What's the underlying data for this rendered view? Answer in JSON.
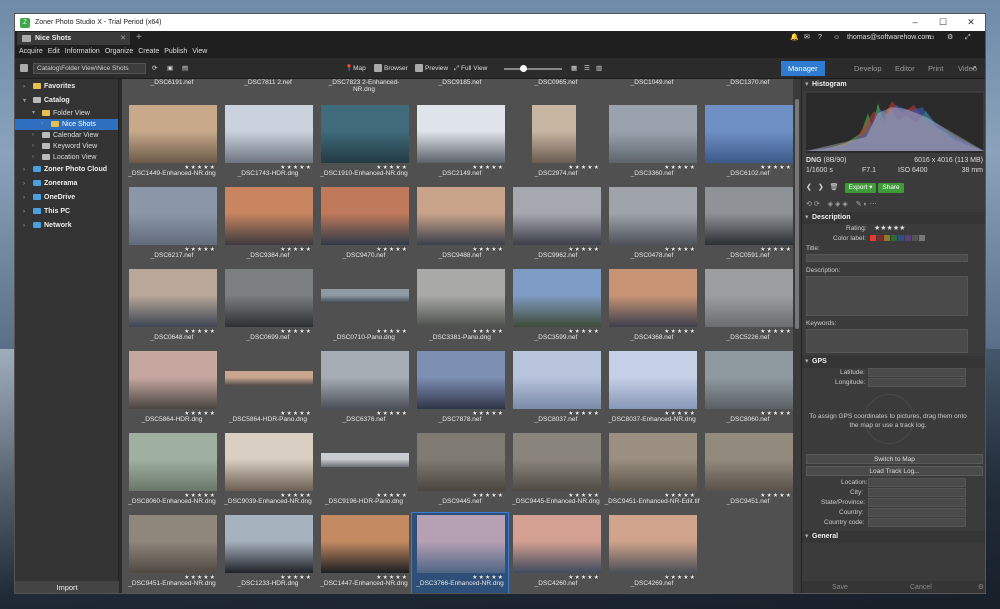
{
  "window": {
    "title": "Zoner Photo Studio X - Trial Period (x64)",
    "tab": "Nice Shots",
    "account": "thomas@softwarehow.com"
  },
  "menu": [
    "Acquire",
    "Edit",
    "Information",
    "Organize",
    "Create",
    "Publish",
    "View"
  ],
  "toolbar": {
    "path": "Catalog\\Folder View\\Nice Shots",
    "map": "Map",
    "browser": "Browser",
    "preview": "Preview",
    "full_view": "Full View"
  },
  "modes": [
    "Manager",
    "Develop",
    "Editor",
    "Print",
    "Video"
  ],
  "sidebar": {
    "items": [
      {
        "label": "Favorites",
        "level": 0,
        "bold": true,
        "color": "#e5c04a"
      },
      {
        "label": "Catalog",
        "level": 0,
        "bold": true,
        "color": "#bbbbbb"
      },
      {
        "label": "Folder View",
        "level": 1,
        "bold": false,
        "color": "#e5c04a"
      },
      {
        "label": "Nice Shots",
        "level": 2,
        "bold": false,
        "color": "#e5c04a",
        "selected": true
      },
      {
        "label": "Calendar View",
        "level": 1,
        "bold": false,
        "color": "#bbbbbb"
      },
      {
        "label": "Keyword View",
        "level": 1,
        "bold": false,
        "color": "#bbbbbb"
      },
      {
        "label": "Location View",
        "level": 1,
        "bold": false,
        "color": "#bbbbbb"
      },
      {
        "label": "Zoner Photo Cloud",
        "level": 0,
        "bold": true,
        "color": "#4aa0e0"
      },
      {
        "label": "Zonerama",
        "level": 0,
        "bold": true,
        "color": "#4aa0e0"
      },
      {
        "label": "OneDrive",
        "level": 0,
        "bold": true,
        "color": "#4aa0e0"
      },
      {
        "label": "This PC",
        "level": 0,
        "bold": true,
        "color": "#4aa0e0"
      },
      {
        "label": "Network",
        "level": 0,
        "bold": true,
        "color": "#4aa0e0"
      }
    ],
    "import": "Import"
  },
  "top_row": [
    "_DSC6191.nef",
    "_DSC7811 2.nef",
    "_DSC7823 2-Enhanced-NR.dng",
    "_DSC9185.nef",
    "_DSC0965.nef",
    "_DSC1049.nef",
    "_DSC1370.nef"
  ],
  "photos": [
    {
      "name": "_DSC1449-Enhanced-NR.dng",
      "c1": "#c7a98a",
      "c2": "#6b5a48",
      "shape": "normal"
    },
    {
      "name": "_DSC1743-HDR.dng",
      "c1": "#c9d2dd",
      "c2": "#6e7580",
      "shape": "normal"
    },
    {
      "name": "_DSC1910-Enhanced-NR.dng",
      "c1": "#3f6b7a",
      "c2": "#233a44",
      "shape": "normal"
    },
    {
      "name": "_DSC2149.nef",
      "c1": "#dfe4ea",
      "c2": "#5c626a",
      "shape": "normal"
    },
    {
      "name": "_DSC2974.nef",
      "c1": "#c8b5a2",
      "c2": "#6a5d50",
      "shape": "tall"
    },
    {
      "name": "_DSC3360.nef",
      "c1": "#9aa3ad",
      "c2": "#5d646c",
      "shape": "normal"
    },
    {
      "name": "_DSC6102.nef",
      "c1": "#6f90c4",
      "c2": "#3b5a8a",
      "shape": "normal"
    },
    {
      "name": "_DSC6217.nef",
      "c1": "#8b97a8",
      "c2": "#616b7a",
      "shape": "normal"
    },
    {
      "name": "_DSC9384.nef",
      "c1": "#c88560",
      "c2": "#3d3a40",
      "shape": "normal"
    },
    {
      "name": "_DSC9470.nef",
      "c1": "#c07a5b",
      "c2": "#2f3a4a",
      "shape": "normal"
    },
    {
      "name": "_DSC9488.nef",
      "c1": "#c9a38a",
      "c2": "#3b3f4a",
      "shape": "normal"
    },
    {
      "name": "_DSC9962.nef",
      "c1": "#a6a8b0",
      "c2": "#3a3e48",
      "shape": "normal"
    },
    {
      "name": "_DSC0478.nef",
      "c1": "#9fa4ab",
      "c2": "#4d525a",
      "shape": "normal"
    },
    {
      "name": "_DSC0591.nef",
      "c1": "#8f9398",
      "c2": "#2c2f33",
      "shape": "normal"
    },
    {
      "name": "_DSC0648.nef",
      "c1": "#b9a89a",
      "c2": "#3c4452",
      "shape": "normal"
    },
    {
      "name": "_DSC0699.nef",
      "c1": "#7c7f80",
      "c2": "#2d3030",
      "shape": "normal"
    },
    {
      "name": "_DSC0710-Pano.dng",
      "c1": "#8f9aa3",
      "c2": "#41484f",
      "shape": "pano"
    },
    {
      "name": "_DSC3381-Pano.dng",
      "c1": "#a9aaa8",
      "c2": "#4d504c",
      "shape": "normal"
    },
    {
      "name": "_DSC3599.nef",
      "c1": "#7f9cc4",
      "c2": "#3e4b3a",
      "shape": "normal"
    },
    {
      "name": "_DSC4368.nef",
      "c1": "#c89476",
      "c2": "#3c3f4c",
      "shape": "normal"
    },
    {
      "name": "_DSC5226.nef",
      "c1": "#9c9e9f",
      "c2": "#6a6c6d",
      "shape": "normal"
    },
    {
      "name": "_DSC5864-HDR.dng",
      "c1": "#c5a7a0",
      "c2": "#4a4540",
      "shape": "normal"
    },
    {
      "name": "_DSC5864-HDR-Pano.dng",
      "c1": "#c9a48e",
      "c2": "#5a5250",
      "shape": "pano"
    },
    {
      "name": "_DSC6376.nef",
      "c1": "#a6adb5",
      "c2": "#4b5058",
      "shape": "normal"
    },
    {
      "name": "_DSC7878.nef",
      "c1": "#7e8fb4",
      "c2": "#2f3548",
      "shape": "normal"
    },
    {
      "name": "_DSC8037.nef",
      "c1": "#b8c4dc",
      "c2": "#7a8aa8",
      "shape": "normal"
    },
    {
      "name": "_DSC8037-Enhanced-NR.dng",
      "c1": "#c6d0e6",
      "c2": "#8797b8",
      "shape": "normal"
    },
    {
      "name": "_DSC8060.nef",
      "c1": "#8e9aa0",
      "c2": "#5a6064",
      "shape": "normal"
    },
    {
      "name": "_DSC8060-Enhanced-NR.dng",
      "c1": "#9fb0a0",
      "c2": "#6a7768",
      "shape": "normal"
    },
    {
      "name": "_DSC9039-Enhanced-NR.dng",
      "c1": "#d9cfc3",
      "c2": "#6b5e52",
      "shape": "normal"
    },
    {
      "name": "_DSC9196-HDR-Pano.dng",
      "c1": "#c9ccd0",
      "c2": "#6c7074",
      "shape": "pano"
    },
    {
      "name": "_DSC9445.nef",
      "c1": "#7f7a72",
      "c2": "#4a463f",
      "shape": "normal"
    },
    {
      "name": "_DSC9445-Enhanced-NR.dng",
      "c1": "#8a857c",
      "c2": "#4f4b44",
      "shape": "normal"
    },
    {
      "name": "_DSC9451-Enhanced-NR-Edit.tif",
      "c1": "#9a8f80",
      "c2": "#5a5248",
      "shape": "normal"
    },
    {
      "name": "_DSC9451.nef",
      "c1": "#938a7e",
      "c2": "#59524a",
      "shape": "normal"
    },
    {
      "name": "_DSC9451-Enhanced-NR.dng",
      "c1": "#8f877c",
      "c2": "#4e4841",
      "shape": "normal"
    },
    {
      "name": "_DSC1233-HDR.dng",
      "c1": "#a7b2bf",
      "c2": "#1f2228",
      "shape": "normal"
    },
    {
      "name": "_DSC1447-Enhanced-NR.dng",
      "c1": "#c48a62",
      "c2": "#1c1f24",
      "shape": "normal"
    },
    {
      "name": "_DSC3766-Enhanced-NR.dng",
      "c1": "#b6a0b4",
      "c2": "#4f6585",
      "shape": "normal",
      "selected": true
    },
    {
      "name": "_DSC4260.nef",
      "c1": "#d4a091",
      "c2": "#3f4a5e",
      "shape": "normal"
    },
    {
      "name": "_DSC4269.nef",
      "c1": "#d0a48a",
      "c2": "#4a4e58",
      "shape": "normal"
    }
  ],
  "stars": "★★★★★",
  "panel": {
    "histogram_title": "Histogram",
    "format": "DNG",
    "format_detail": "(8B/90)",
    "dimensions": "6016 x 4016 (113 MB)",
    "shutter": "1/1600 s",
    "aperture": "F7.1",
    "iso": "ISO 6400",
    "focal": "38 mm",
    "export": "Export",
    "share": "Share",
    "description_title": "Description",
    "rating_label": "Rating:",
    "color_label": "Color label:",
    "title_label": "Title:",
    "description_label": "Description:",
    "keywords_label": "Keywords:",
    "gps_title": "GPS",
    "latitude_label": "Latitude:",
    "longitude_label": "Longitude:",
    "gps_hint": "To assign GPS coordinates to pictures, drag them onto the map or use a track log.",
    "switch_map": "Switch to Map",
    "load_track": "Load Track Log...",
    "location_label": "Location:",
    "city_label": "City:",
    "state_label": "State/Province:",
    "country_label": "Country:",
    "country_code_label": "Country code:",
    "general_title": "General",
    "save": "Save",
    "cancel": "Cancel"
  },
  "colors": {
    "accent": "#2f7bd1",
    "green": "#3f9a3a"
  }
}
